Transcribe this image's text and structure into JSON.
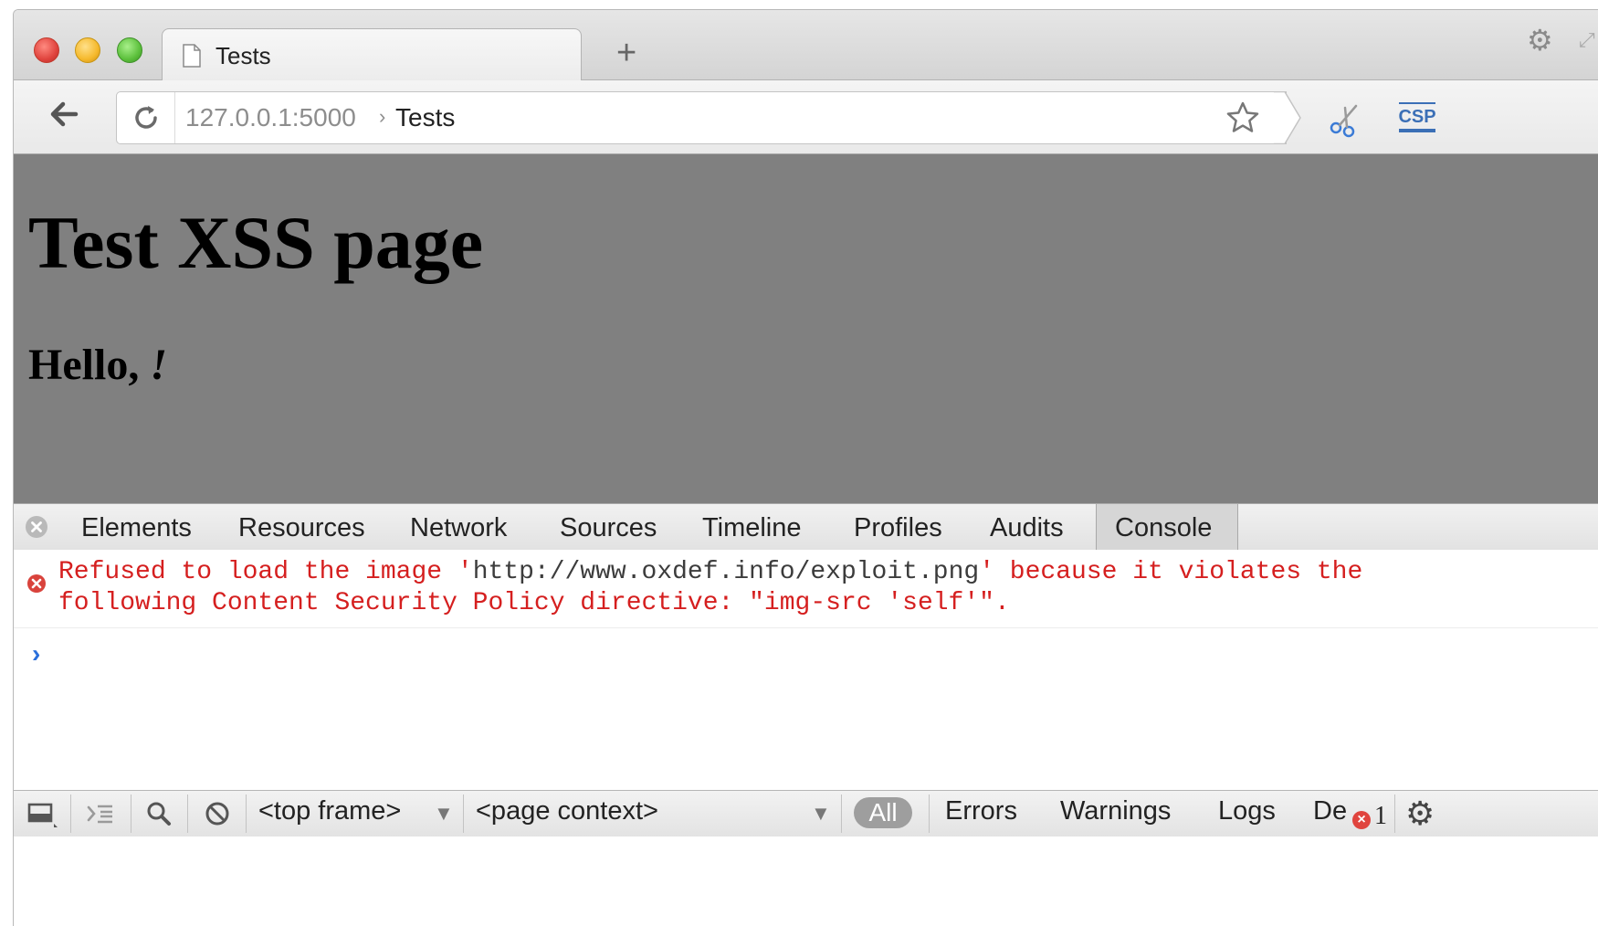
{
  "browser": {
    "tab_title": "Tests",
    "new_tab_label": "+",
    "url_host": "127.0.0.1:5000",
    "url_separator": "›",
    "url_path": "Tests",
    "extension_csp_label": "CSP"
  },
  "page": {
    "heading": "Test XSS page",
    "greeting_prefix": "Hello, ",
    "greeting_suffix": "!"
  },
  "devtools": {
    "tabs": [
      "Elements",
      "Resources",
      "Network",
      "Sources",
      "Timeline",
      "Profiles",
      "Audits",
      "Console"
    ],
    "active_tab": "Console",
    "console": {
      "error_prefix": "Refused to load the image '",
      "error_url": "http://www.oxdef.info/exploit.png",
      "error_suffix": "' because it violates the following Content Security Policy directive: \"img-src 'self'\".",
      "prompt": "›"
    },
    "bottom_bar": {
      "frame_select": "<top frame>",
      "context_select": "<page context>",
      "filters": [
        "All",
        "Errors",
        "Warnings",
        "Logs",
        "De"
      ],
      "active_filter": "All",
      "error_count": "1"
    }
  },
  "colors": {
    "page_background": "#808080",
    "error_text": "#d51f1f",
    "prompt_caret": "#2a6fdb"
  }
}
